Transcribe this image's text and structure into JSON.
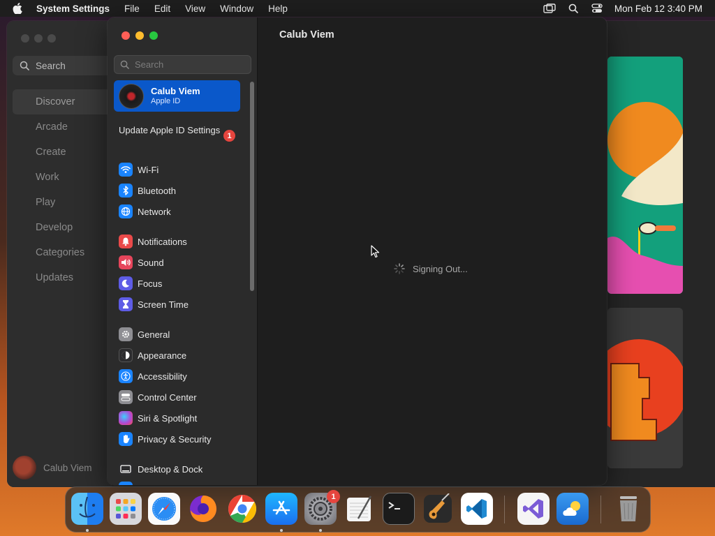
{
  "menubar": {
    "app_name": "System Settings",
    "menus": [
      "File",
      "Edit",
      "View",
      "Window",
      "Help"
    ],
    "clock": "Mon Feb 12  3:40 PM"
  },
  "app_store": {
    "search_placeholder": "Search",
    "nav": [
      "Discover",
      "Arcade",
      "Create",
      "Work",
      "Play",
      "Develop",
      "Categories",
      "Updates"
    ],
    "active_nav": "Discover",
    "user_name": "Calub Viem"
  },
  "settings": {
    "search_placeholder": "Search",
    "account": {
      "name": "Calub Viem",
      "subtitle": "Apple ID"
    },
    "update_row": {
      "label": "Update Apple ID Settings",
      "badge": "1"
    },
    "items": [
      {
        "label": "Wi-Fi",
        "icon": "wifi-icon",
        "color": "#1a84ff"
      },
      {
        "label": "Bluetooth",
        "icon": "bluetooth-icon",
        "color": "#1a84ff"
      },
      {
        "label": "Network",
        "icon": "globe-icon",
        "color": "#1a84ff"
      },
      {
        "label": "Notifications",
        "icon": "bell-icon",
        "color": "#ea4a4a"
      },
      {
        "label": "Sound",
        "icon": "speaker-icon",
        "color": "#e6455b"
      },
      {
        "label": "Focus",
        "icon": "moon-icon",
        "color": "#5e5ce6"
      },
      {
        "label": "Screen Time",
        "icon": "hourglass-icon",
        "color": "#5e5ce6"
      },
      {
        "label": "General",
        "icon": "gear-icon",
        "color": "#8e8e93"
      },
      {
        "label": "Appearance",
        "icon": "appearance-icon",
        "color": "#2c2c2e"
      },
      {
        "label": "Accessibility",
        "icon": "accessibility-icon",
        "color": "#1a84ff"
      },
      {
        "label": "Control Center",
        "icon": "control-center-icon",
        "color": "#8e8e93"
      },
      {
        "label": "Siri & Spotlight",
        "icon": "siri-icon",
        "color": "#b04ad6"
      },
      {
        "label": "Privacy & Security",
        "icon": "hand-icon",
        "color": "#1a84ff"
      },
      {
        "label": "Desktop & Dock",
        "icon": "desktop-icon",
        "color": "#2c2c2e"
      }
    ],
    "main_title": "Calub Viem",
    "status": "Signing Out..."
  },
  "dock": {
    "apps": [
      {
        "name": "finder-icon",
        "running": true
      },
      {
        "name": "launchpad-icon",
        "running": false
      },
      {
        "name": "safari-icon",
        "running": false
      },
      {
        "name": "firefox-icon",
        "running": false
      },
      {
        "name": "chrome-icon",
        "running": false
      },
      {
        "name": "app-store-icon",
        "running": true
      },
      {
        "name": "system-settings-icon",
        "running": true,
        "badge": "1"
      },
      {
        "name": "textedit-icon",
        "running": false
      },
      {
        "name": "terminal-icon",
        "running": false
      },
      {
        "name": "garageband-icon",
        "running": false
      },
      {
        "name": "vscode-icon",
        "running": false
      },
      {
        "name": "visual-studio-icon",
        "running": false
      },
      {
        "name": "weather-icon",
        "running": false
      },
      {
        "name": "trash-icon",
        "running": false
      }
    ]
  }
}
